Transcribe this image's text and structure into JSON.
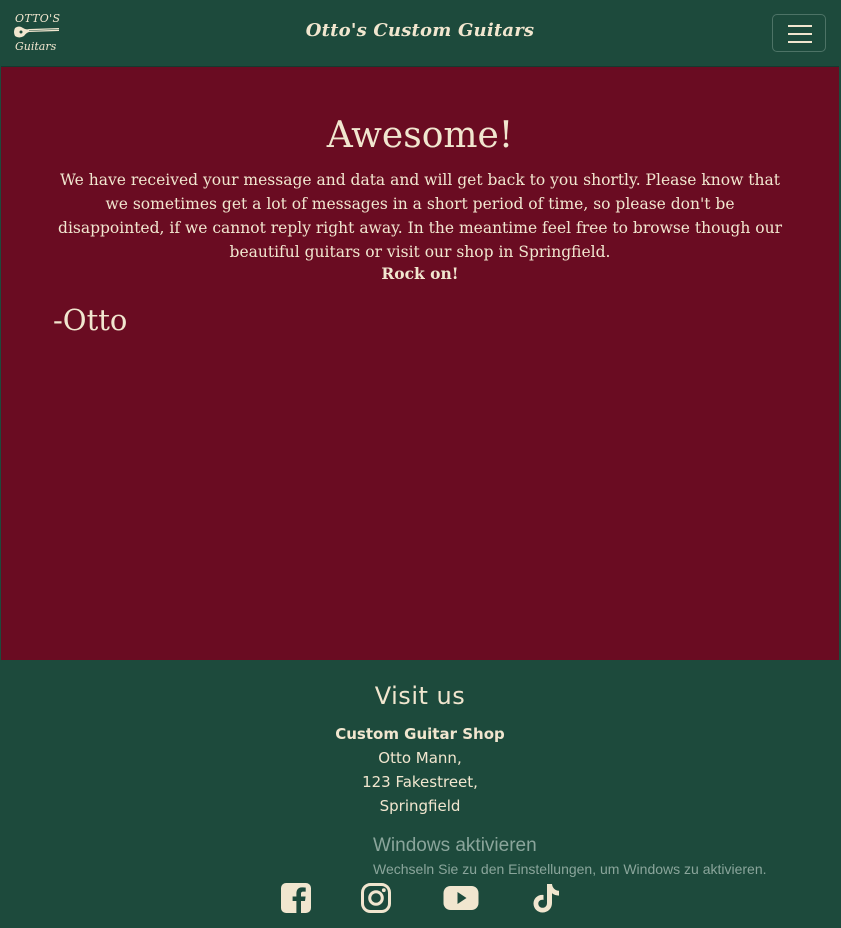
{
  "header": {
    "logo_line1": "OTTO'S",
    "logo_line2": "Guitars",
    "brand": "Otto's Custom Guitars",
    "menu_icon": "hamburger-menu-icon"
  },
  "main": {
    "heading": "Awesome!",
    "message": "We have received your message and data and will get back to you shortly. Please know that we sometimes get a lot of messages in a short period of time, so please don't be disappointed, if we cannot reply right away. In the meantime feel free to browse though our beautiful guitars or visit our shop in Springfield.",
    "closing": "Rock on!",
    "signature": "-Otto"
  },
  "footer": {
    "heading": "Visit us",
    "shop_name": "Custom Guitar Shop",
    "address_lines": [
      "Otto Mann,",
      "123 Fakestreet,",
      "Springfield"
    ],
    "social": [
      "facebook-icon",
      "instagram-icon",
      "youtube-icon",
      "tiktok-icon"
    ]
  },
  "overlay": {
    "title": "Windows aktivieren",
    "subtitle": "Wechseln Sie zu den Einstellungen, um Windows zu aktivieren."
  },
  "colors": {
    "green": "#1d4a3c",
    "burgundy": "#6a0c22",
    "cream": "#f1e6cf"
  }
}
